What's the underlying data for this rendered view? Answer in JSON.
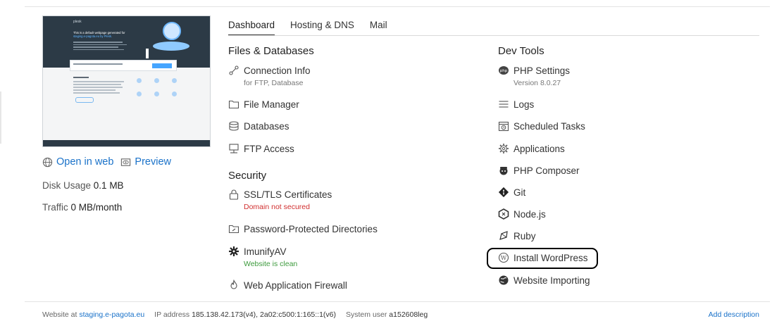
{
  "preview": {
    "brand": "plesk",
    "headline_1": "This is a default webpage generated for",
    "headline_2": "staging.e-pagota.eu by Plesk.",
    "open_in_web": "Open in web",
    "preview": "Preview"
  },
  "stats": {
    "disk_label": "Disk Usage",
    "disk_value": "0.1 MB",
    "traffic_label": "Traffic",
    "traffic_value": "0 MB/month"
  },
  "tabs": [
    "Dashboard",
    "Hosting & DNS",
    "Mail"
  ],
  "files_databases": {
    "title": "Files & Databases",
    "items": [
      {
        "label": "Connection Info",
        "sub": "for FTP, Database",
        "icon": "connection-icon"
      },
      {
        "label": "File Manager",
        "icon": "folder-icon"
      },
      {
        "label": "Databases",
        "icon": "database-icon"
      },
      {
        "label": "FTP Access",
        "icon": "ftp-icon"
      }
    ]
  },
  "security": {
    "title": "Security",
    "items": [
      {
        "label": "SSL/TLS Certificates",
        "sub": "Domain not secured",
        "icon": "lock-icon"
      },
      {
        "label": "Password-Protected Directories",
        "icon": "protected-folder-icon"
      },
      {
        "label": "ImunifyAV",
        "sub": "Website is clean",
        "icon": "imunify-icon"
      },
      {
        "label": "Web Application Firewall",
        "icon": "firewall-icon"
      }
    ]
  },
  "dev_tools": {
    "title": "Dev Tools",
    "items": [
      {
        "label": "PHP Settings",
        "sub": "Version 8.0.27",
        "icon": "php-icon"
      },
      {
        "label": "Logs",
        "icon": "logs-icon"
      },
      {
        "label": "Scheduled Tasks",
        "icon": "calendar-clock-icon"
      },
      {
        "label": "Applications",
        "icon": "gear-icon"
      },
      {
        "label": "PHP Composer",
        "icon": "composer-icon"
      },
      {
        "label": "Git",
        "icon": "git-icon"
      },
      {
        "label": "Node.js",
        "icon": "nodejs-icon"
      },
      {
        "label": "Ruby",
        "icon": "ruby-icon"
      },
      {
        "label": "Install WordPress",
        "icon": "wordpress-icon"
      },
      {
        "label": "Website Importing",
        "icon": "globe-import-icon"
      }
    ]
  },
  "footer": {
    "website_label": "Website at",
    "website_value": "staging.e-pagota.eu",
    "ip_label": "IP address",
    "ip_value": "185.138.42.173(v4), 2a02:c500:1:165::1(v6)",
    "user_label": "System user",
    "user_value": "a152608leg",
    "add_description": "Add description"
  },
  "colors": {
    "link": "#1a72c9",
    "error": "#d12f2f",
    "success": "#3c9a3c"
  }
}
